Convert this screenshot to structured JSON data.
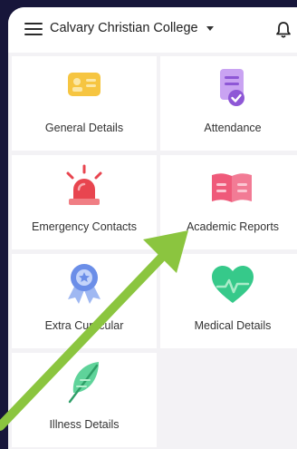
{
  "header": {
    "title": "Calvary Christian College",
    "menu_icon": "hamburger-menu-icon",
    "dropdown_icon": "caret-down-icon",
    "notification_icon": "bell-icon"
  },
  "tiles": [
    {
      "label": "General Details",
      "icon": "id-card-icon",
      "color": "#f6c541"
    },
    {
      "label": "Attendance",
      "icon": "clipboard-check-icon",
      "color": "#a974e0"
    },
    {
      "label": "Emergency Contacts",
      "icon": "siren-alarm-icon",
      "color": "#e8454f"
    },
    {
      "label": "Academic Reports",
      "icon": "open-book-icon",
      "color": "#ef5a7a"
    },
    {
      "label": "Extra Curricular",
      "icon": "award-ribbon-icon",
      "color": "#6b8ee8"
    },
    {
      "label": "Medical Details",
      "icon": "heart-icon",
      "color": "#36c98a"
    },
    {
      "label": "Illness Details",
      "icon": "feather-icon",
      "color": "#5fd39a"
    }
  ],
  "annotation": {
    "arrow_color": "#8bc53f",
    "icon": "pointer-arrow-icon"
  }
}
